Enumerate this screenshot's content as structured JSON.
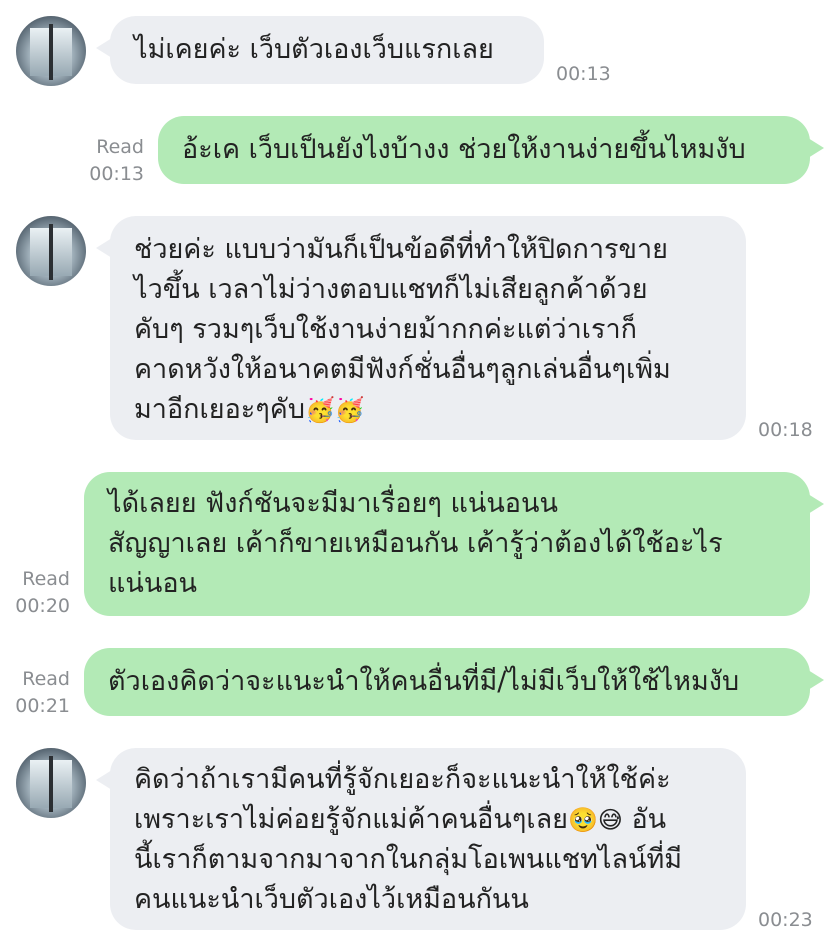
{
  "messages": [
    {
      "id": "m1",
      "side": "in",
      "lines": [
        "ไม่เคยค่ะ เว็บตัวเองเว็บแรกเลย"
      ],
      "time": "00:13"
    },
    {
      "id": "m2",
      "side": "out",
      "lines": [
        "อ้ะเค เว็บเป็นยังไงบ้างง ช่วยให้งานง่ายขึ้นไหมงับ"
      ],
      "read": "Read",
      "time": "00:13"
    },
    {
      "id": "m3",
      "side": "in",
      "lines": [
        "ช่วยค่ะ แบบว่ามันก็เป็นข้อดีที่ทำให้ปิดการขาย",
        "ไวขึ้น เวลาไม่ว่างตอบแชทก็ไม่เสียลูกค้าด้วย",
        "คับๆ รวมๆเว็บใช้งานง่ายม้ากกค่ะแต่ว่าเราก็",
        "คาดหวังให้อนาคตมีฟังก์ชั่นอื่นๆลูกเล่นอื่นๆเพิ่ม",
        "มาอีกเยอะๆคับ"
      ],
      "emoji": "🥳🥳",
      "time": "00:18"
    },
    {
      "id": "m4",
      "side": "out",
      "lines": [
        "ได้เลยย ฟังก์ชันจะมีมาเรื่อยๆ แน่นอนน",
        "สัญญาเลย เค้าก็ขายเหมือนกัน เค้ารู้ว่าต้องได้ใช้อะไร",
        "แน่นอน"
      ],
      "read": "Read",
      "time": "00:20"
    },
    {
      "id": "m5",
      "side": "out",
      "lines": [
        "ตัวเองคิดว่าจะแนะนำให้คนอื่นที่มี/ไม่มีเว็บให้ใช้ไหมงับ"
      ],
      "read": "Read",
      "time": "00:21"
    },
    {
      "id": "m6",
      "side": "in",
      "lines": [
        "คิดว่าถ้าเรามีคนที่รู้จักเยอะก็จะแนะนำให้ใช้ค่ะ",
        "เพราะเราไม่ค่อยรู้จักแม่ค้าคนอื่นๆเลย",
        "นี้เราก็ตามจากมาจากในกลุ่มโอเพนแชทไลน์ที่มี",
        "คนแนะนำเว็บตัวเองไว้เหมือนกันน"
      ],
      "line2_emoji": "🥹😅",
      "line2_tail": " อัน",
      "time": "00:23"
    }
  ]
}
